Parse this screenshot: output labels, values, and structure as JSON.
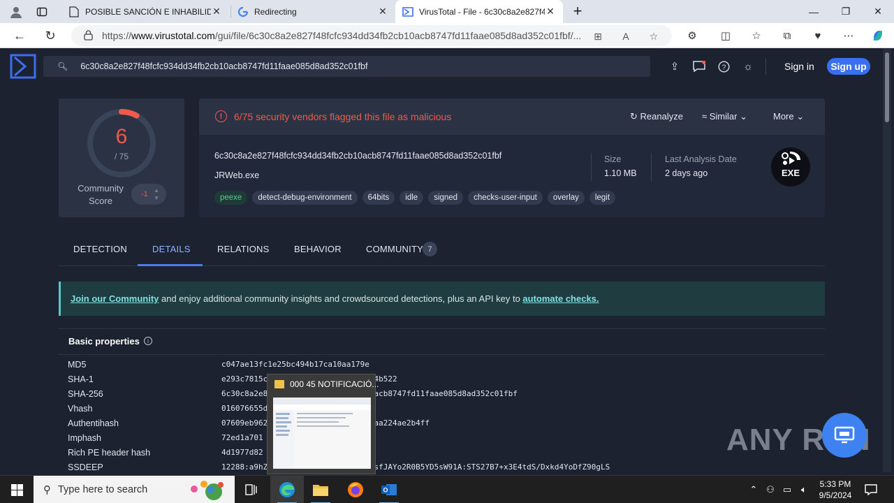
{
  "browser": {
    "tabs": [
      {
        "label": "POSIBLE SANCIÓN  E INHABILIDAD",
        "icon": "document-icon"
      },
      {
        "label": "Redirecting",
        "icon": "google-icon"
      },
      {
        "label": "VirusTotal - File - 6c30c8a2e827f4",
        "icon": "virustotal-icon",
        "active": true
      }
    ],
    "new_tab": "+",
    "url_prefix": "https://",
    "url_domain": "www.virustotal.com",
    "url_path": "/gui/file/6c30c8a2e827f48fcfc934dd34fb2cb10acb8747fd11faae085d8ad352c01fbf/..."
  },
  "vt": {
    "search_value": "6c30c8a2e827f48fcfc934dd34fb2cb10acb8747fd11faae085d8ad352c01fbf",
    "signin": "Sign in",
    "signup": "Sign up",
    "score": {
      "detected": "6",
      "total": "/ 75",
      "detected_fraction": 0.08,
      "community_label": "Community Score",
      "community_value": "-1"
    },
    "flag_text": "6/75 security vendors flagged this file as malicious",
    "actions": {
      "reanalyze": "Reanalyze",
      "similar": "Similar",
      "more": "More"
    },
    "hash": "6c30c8a2e827f48fcfc934dd34fb2cb10acb8747fd11faae085d8ad352c01fbf",
    "filename": "JRWeb.exe",
    "tags": [
      "peexe",
      "detect-debug-environment",
      "64bits",
      "idle",
      "signed",
      "checks-user-input",
      "overlay",
      "legit"
    ],
    "size_label": "Size",
    "size_value": "1.10 MB",
    "date_label": "Last Analysis Date",
    "date_value": "2 days ago",
    "filetype_badge": "EXE",
    "tabs": [
      "DETECTION",
      "DETAILS",
      "RELATIONS",
      "BEHAVIOR",
      "COMMUNITY"
    ],
    "active_tab": "DETAILS",
    "community_count": "7",
    "banner": {
      "link1": "Join our Community",
      "middle": " and enjoy additional community insights and crowdsourced detections, plus an API key to ",
      "link2": "automate checks."
    },
    "basic_title": "Basic properties",
    "properties": [
      {
        "key": "MD5",
        "value": "c047ae13fc1e25bc494b17ca10aa179e"
      },
      {
        "key": "SHA-1",
        "value": "e293c7815c6e48ad4d50c3a9b27bd01b44b522"
      },
      {
        "key": "SHA-256",
        "value": "6c30c8a2e827f48fcfc934dd34fb2cb10acb8747fd11faae085d8ad352c01fbf"
      },
      {
        "key": "Vhash",
        "value": "016076655d1b4ba05az47fz"
      },
      {
        "key": "Authentihash",
        "value": "07609eb96211c1a8ca02dca68037f1562aa224ae2b4ff"
      },
      {
        "key": "Imphash",
        "value": "72ed1a701"
      },
      {
        "key": "Rich PE header hash",
        "value": "4d1977d82"
      },
      {
        "key": "SSDEEP",
        "value": "12288:a9hZ...DxsVyY4YoUwpf5kpRG6xsfJAYo2R0B5YD5sW91A:STS27B7+x3E4tdS/Dxkd4YoDfZ90gLS"
      }
    ]
  },
  "thumbnail": {
    "title": "000 45 NOTIFICACIÓ..."
  },
  "watermark": "ANY RUN",
  "taskbar": {
    "search_placeholder": "Type here to search",
    "time": "5:33 PM",
    "date": "9/5/2024"
  },
  "colors": {
    "accent": "#3a6ff0",
    "malicious": "#ef5a4a",
    "bg": "#1c2230",
    "card": "#2a3244"
  }
}
